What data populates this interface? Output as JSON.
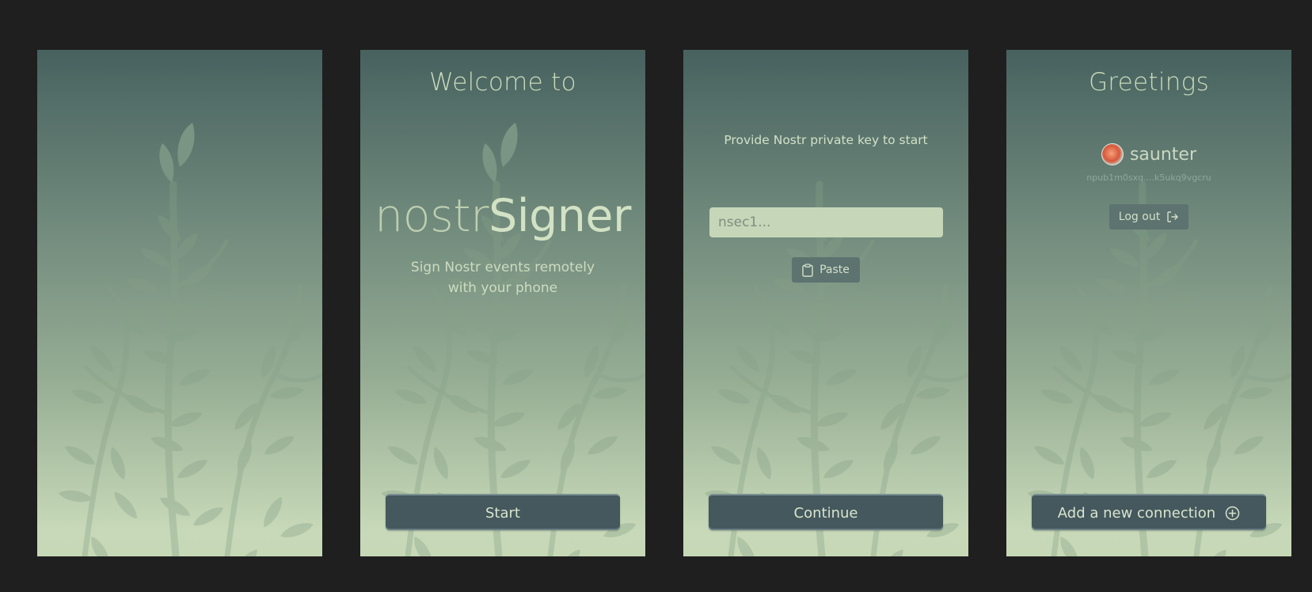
{
  "screens": [
    {
      "id": "splash"
    },
    {
      "id": "welcome",
      "title": "Welcome to",
      "brand_light": "nostr",
      "brand_bold": "Signer",
      "tagline_line1": "Sign Nostr events remotely",
      "tagline_line2": "with your phone",
      "primary_button": "Start"
    },
    {
      "id": "import-key",
      "prompt": "Provide Nostr private key to start",
      "key_placeholder": "nsec1...",
      "paste_button": "Paste",
      "primary_button": "Continue"
    },
    {
      "id": "greetings",
      "title": "Greetings",
      "username": "saunter",
      "npub": "npub1m0sxq....k5ukq9vgcru",
      "logout_button": "Log out",
      "primary_button": "Add a new connection"
    }
  ],
  "colors": {
    "page_background": "#1f1f1f",
    "gradient_top": "#47615f",
    "gradient_bottom": "#c6d8b6",
    "button": "#45585d",
    "input": "#c6d6b8"
  },
  "icons": [
    "leaf-logo-icon",
    "clipboard-icon",
    "logout-icon",
    "plus-circle-icon"
  ]
}
